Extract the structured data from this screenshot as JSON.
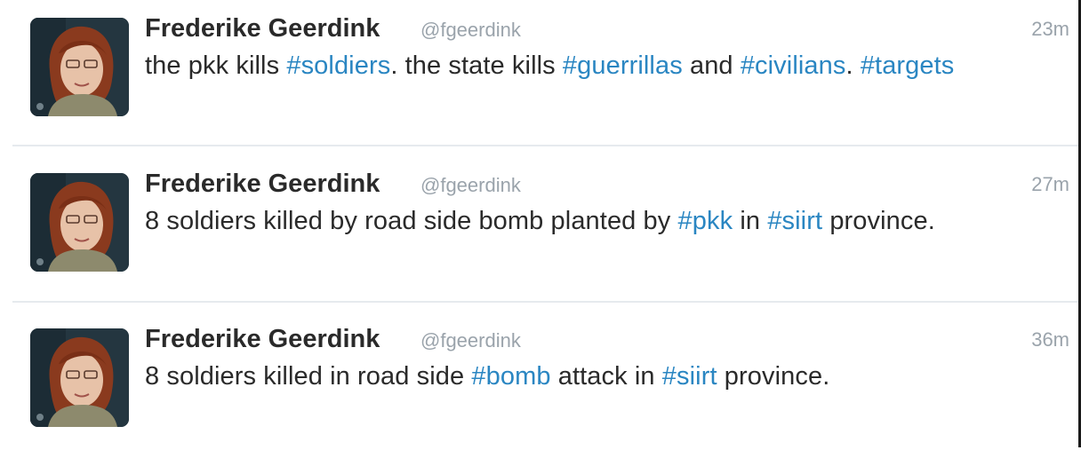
{
  "colors": {
    "text": "#2a2a2a",
    "muted": "#9aa3ab",
    "hashtag": "#2a86c2",
    "divider": "#e6eaee"
  },
  "tweets": [
    {
      "name": "Frederike Geerdink",
      "handle": "@fgeerdink",
      "time": "23m",
      "avatar_icon": "profile-photo",
      "segments": [
        {
          "text": "the pkk kills ",
          "hashtag": false
        },
        {
          "text": "#soldiers",
          "hashtag": true
        },
        {
          "text": ". the state kills ",
          "hashtag": false
        },
        {
          "text": "#guerrillas",
          "hashtag": true
        },
        {
          "text": " and ",
          "hashtag": false
        },
        {
          "text": "#civilians",
          "hashtag": true
        },
        {
          "text": ". ",
          "hashtag": false
        },
        {
          "text": "#targets",
          "hashtag": true
        }
      ]
    },
    {
      "name": "Frederike Geerdink",
      "handle": "@fgeerdink",
      "time": "27m",
      "avatar_icon": "profile-photo",
      "segments": [
        {
          "text": "8 soldiers killed by road side bomb planted by ",
          "hashtag": false
        },
        {
          "text": "#pkk",
          "hashtag": true
        },
        {
          "text": " in ",
          "hashtag": false
        },
        {
          "text": "#siirt",
          "hashtag": true
        },
        {
          "text": " province.",
          "hashtag": false
        }
      ]
    },
    {
      "name": "Frederike Geerdink",
      "handle": "@fgeerdink",
      "time": "36m",
      "avatar_icon": "profile-photo",
      "segments": [
        {
          "text": "8 soldiers killed in road side ",
          "hashtag": false
        },
        {
          "text": "#bomb",
          "hashtag": true
        },
        {
          "text": " attack in ",
          "hashtag": false
        },
        {
          "text": "#siirt",
          "hashtag": true
        },
        {
          "text": " province.",
          "hashtag": false
        }
      ]
    }
  ]
}
